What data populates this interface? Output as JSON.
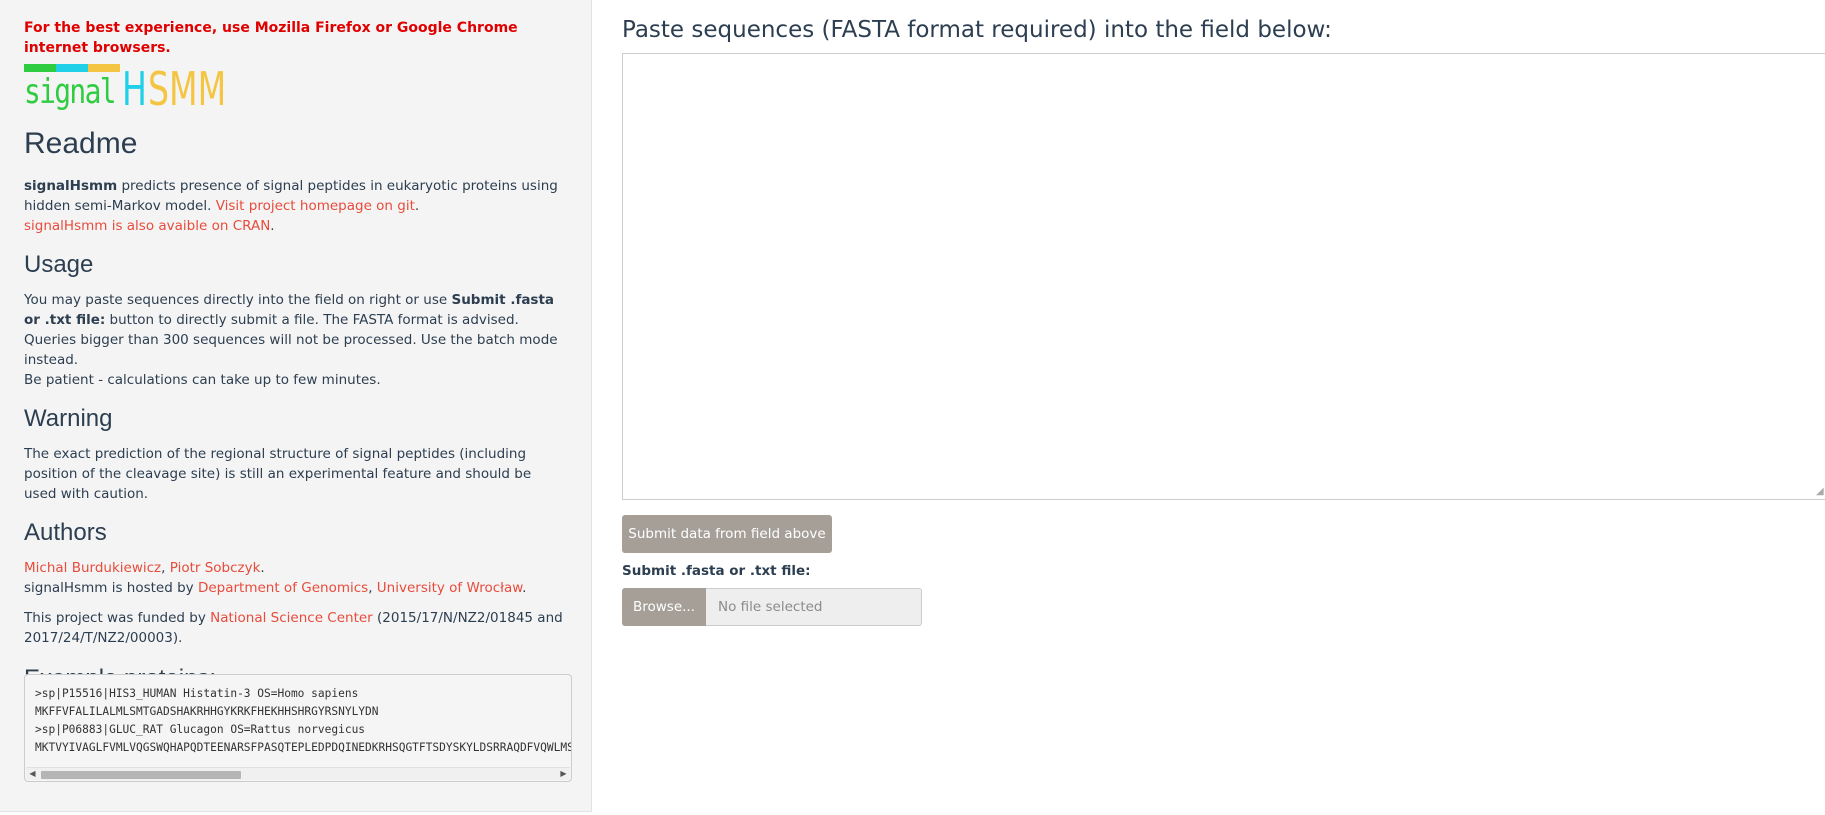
{
  "sidebar": {
    "browser_warning": "For the best experience, use Mozilla Firefox or Google Chrome internet browsers.",
    "logo": {
      "word1": "signal",
      "word2": "H",
      "word3": "SMM",
      "bar_colors": [
        "#2ecc40",
        "#1fd0e8",
        "#f4c542"
      ]
    },
    "readme": {
      "heading": "Readme",
      "app_name": "signalHsmm",
      "desc": " predicts presence of signal peptides in eukaryotic proteins using hidden semi-Markov model. ",
      "link_git": "Visit project homepage on git",
      "period": ".",
      "link_cran": "signalHsmm is also avaible on CRAN",
      "period2": "."
    },
    "usage": {
      "heading": "Usage",
      "line1_a": "You may paste sequences directly into the field on right or use ",
      "line1_bold": "Submit .fasta or .txt file:",
      "line1_b": " button to directly submit a file. The FASTA format is advised.",
      "line2": "Queries bigger than 300 sequences will not be processed. Use the batch mode instead.",
      "line3": "Be patient - calculations can take up to few minutes."
    },
    "warning": {
      "heading": "Warning",
      "text": "The exact prediction of the regional structure of signal peptides (including position of the cleavage site) is still an experimental feature and should be used with caution."
    },
    "authors": {
      "heading": "Authors",
      "author1": "Michal Burdukiewicz",
      "sep": ", ",
      "author2": "Piotr Sobczyk",
      "period": ".",
      "hosted_a": "signalHsmm is hosted by ",
      "dept": "Department of Genomics",
      "sep2": ", ",
      "univ": "University of Wrocław",
      "period2": ".",
      "funded_a": "This project was funded by ",
      "funder": "National Science Center",
      "funded_b": " (2015/17/N/NZ2/01845 and 2017/24/T/NZ2/00003)."
    },
    "examples": {
      "heading": "Example proteins:",
      "lines": [
        ">sp|P15516|HIS3_HUMAN Histatin-3 OS=Homo sapiens",
        "MKFFVFALILALMLSMTGADSHAKRHHGYKRKFHEKHHSHRGYRSNYLYDN",
        ">sp|P06883|GLUC_RAT Glucagon OS=Rattus norvegicus",
        "MKTVYIVAGLFVMLVQGSWQHAPQDTEENARSFPASQTEPLEDPDQINEDKRHSQGTFTSDYSKYLDSRRAQDFVQWLMSTKRNGQ"
      ]
    }
  },
  "main": {
    "heading": "Paste sequences (FASTA format required) into the field below:",
    "textarea_value": "",
    "submit_label": "Submit data from field above",
    "file_label": "Submit .fasta or .txt file:",
    "browse_label": "Browse...",
    "file_placeholder": "No file selected"
  }
}
